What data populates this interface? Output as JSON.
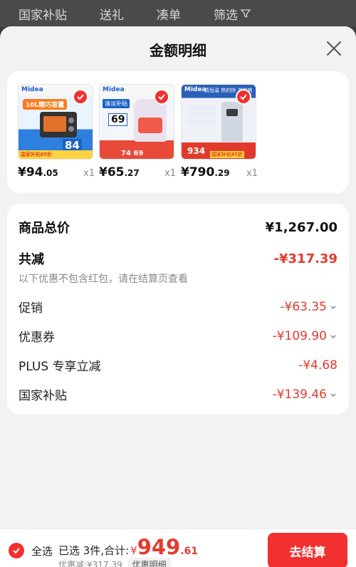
{
  "topbar": {
    "items": [
      "国家补贴",
      "送礼",
      "凑单",
      "筛选"
    ]
  },
  "sheet": {
    "title": "金额明细"
  },
  "products": [
    {
      "price_int": "¥94",
      "price_dec": ".05",
      "qty": "x1",
      "thumb_brand": "Midea",
      "thumb_label": "10L精巧容量",
      "thumb_badge": "84",
      "thumb_footer": "国家补贴85折"
    },
    {
      "price_int": "¥65",
      "price_dec": ".27",
      "qty": "x1",
      "thumb_brand": "Midea",
      "thumb_label": "清淡补贴",
      "thumb_badge": "69",
      "thumb_footer": "74  69"
    },
    {
      "price_int": "¥790",
      "price_dec": ".29",
      "qty": "x1",
      "thumb_brand": "Midea",
      "thumb_label": "真恒温 热的快 洗的爽",
      "thumb_badge": "934",
      "thumb_footer": "国家补贴85折"
    }
  ],
  "summary": {
    "total_label": "商品总价",
    "total_value": "¥1,267.00",
    "reduce_label": "共减",
    "reduce_value": "-¥317.39",
    "note": "以下优惠不包含红包，请在结算页查看",
    "lines": [
      {
        "label": "促销",
        "value": "-¥63.35",
        "expand": true
      },
      {
        "label": "优惠券",
        "value": "-¥109.90",
        "expand": true
      },
      {
        "label": "PLUS 专享立减",
        "value": "-¥4.68",
        "expand": false
      },
      {
        "label": "国家补贴",
        "value": "-¥139.46",
        "expand": true
      }
    ]
  },
  "bottom": {
    "select_all": "全选",
    "selected_text": "已选 3件,合计:",
    "currency": "¥",
    "amount_int": "949",
    "amount_dec": ".61",
    "discount_text": "优惠减:¥317.39",
    "detail_link": "优惠明细",
    "checkout": "去结算"
  },
  "colors": {
    "accent": "#f23030",
    "discount_text": "#e33b30",
    "sheet_bg": "#f2f2f2"
  }
}
